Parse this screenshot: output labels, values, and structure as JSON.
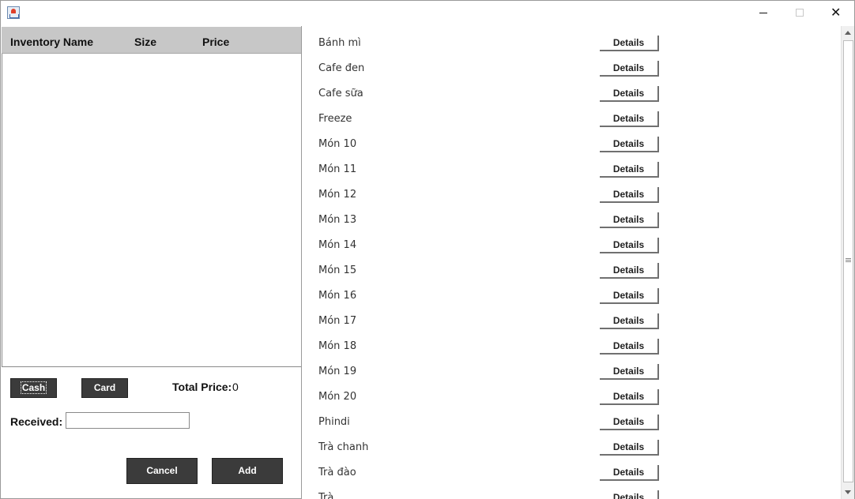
{
  "window": {
    "icon": "java-coffee-icon",
    "controls": {
      "minimize": "minimize-icon",
      "maximize": "maximize-icon",
      "close": "close-icon",
      "close_glyph": "✕"
    }
  },
  "order_table": {
    "columns": [
      "Inventory Name",
      "Size",
      "Price"
    ],
    "rows": []
  },
  "payment": {
    "cash_label": "Cash",
    "card_label": "Card",
    "total_label": "Total Price:",
    "total_value": "0",
    "received_label": "Received:",
    "received_value": ""
  },
  "actions": {
    "cancel_label": "Cancel",
    "add_label": "Add"
  },
  "menu": {
    "details_label": "Details",
    "items": [
      "Bánh mì",
      "Cafe đen",
      "Cafe sữa",
      "Freeze",
      "Món 10",
      "Món 11",
      "Món 12",
      "Món 13",
      "Món 14",
      "Món 15",
      "Món 16",
      "Món 17",
      "Món 18",
      "Món 19",
      "Món 20",
      "Phindi",
      "Trà chanh",
      "Trà đào",
      "Trà ..."
    ]
  },
  "colors": {
    "dark_button": "#3b3b3b",
    "table_header": "#c7c7c7"
  }
}
